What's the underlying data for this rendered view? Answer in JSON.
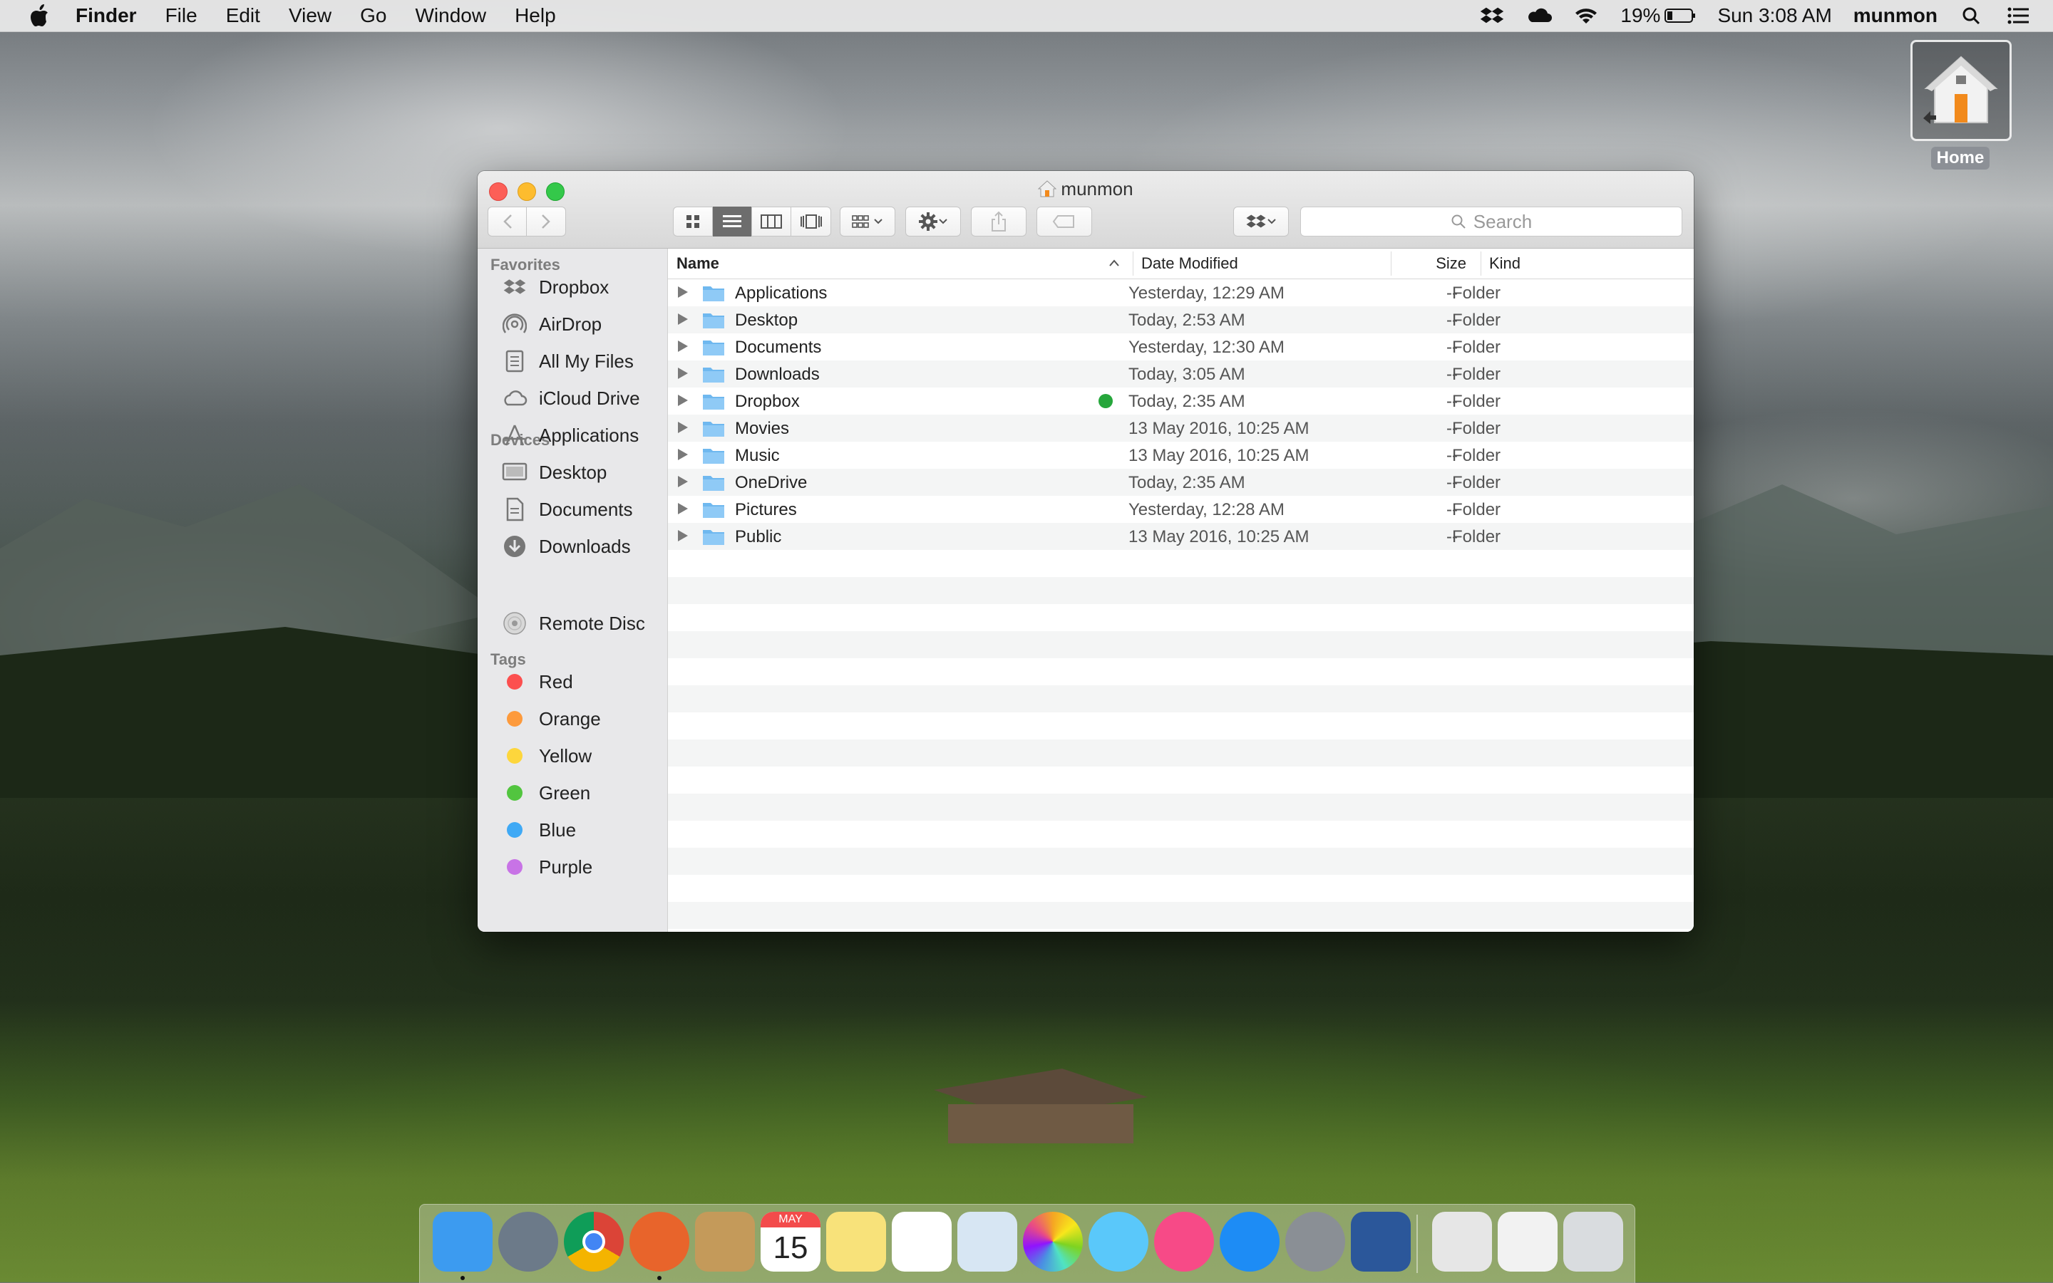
{
  "menubar": {
    "app_name": "Finder",
    "items": [
      "File",
      "Edit",
      "View",
      "Go",
      "Window",
      "Help"
    ],
    "battery": "19%",
    "clock": "Sun 3:08 AM",
    "user": "munmon"
  },
  "desktop": {
    "home_label": "Home"
  },
  "window": {
    "title": "munmon",
    "search_placeholder": "Search"
  },
  "sidebar": {
    "favorites_header": "Favorites",
    "favorites": [
      {
        "label": "Dropbox",
        "icon": "dropbox-icon"
      },
      {
        "label": "AirDrop",
        "icon": "airdrop-icon"
      },
      {
        "label": "All My Files",
        "icon": "all-files-icon"
      },
      {
        "label": "iCloud Drive",
        "icon": "cloud-icon"
      },
      {
        "label": "Applications",
        "icon": "applications-icon"
      },
      {
        "label": "Desktop",
        "icon": "desktop-icon"
      },
      {
        "label": "Documents",
        "icon": "document-icon"
      },
      {
        "label": "Downloads",
        "icon": "download-icon"
      }
    ],
    "devices_header": "Devices",
    "devices": [
      {
        "label": "Remote Disc",
        "icon": "disc-icon"
      }
    ],
    "tags_header": "Tags",
    "tags": [
      {
        "label": "Red",
        "color": "#fc4f4f"
      },
      {
        "label": "Orange",
        "color": "#fd9a3c"
      },
      {
        "label": "Yellow",
        "color": "#fdd63c"
      },
      {
        "label": "Green",
        "color": "#52c53f"
      },
      {
        "label": "Blue",
        "color": "#3fa9f5"
      },
      {
        "label": "Purple",
        "color": "#c873e6"
      }
    ]
  },
  "columns": {
    "name": "Name",
    "date": "Date Modified",
    "size": "Size",
    "kind": "Kind"
  },
  "files": [
    {
      "name": "Applications",
      "date": "Yesterday, 12:29 AM",
      "size": "--",
      "kind": "Folder",
      "synced": false
    },
    {
      "name": "Desktop",
      "date": "Today, 2:53 AM",
      "size": "--",
      "kind": "Folder",
      "synced": false
    },
    {
      "name": "Documents",
      "date": "Yesterday, 12:30 AM",
      "size": "--",
      "kind": "Folder",
      "synced": false
    },
    {
      "name": "Downloads",
      "date": "Today, 3:05 AM",
      "size": "--",
      "kind": "Folder",
      "synced": false
    },
    {
      "name": "Dropbox",
      "date": "Today, 2:35 AM",
      "size": "--",
      "kind": "Folder",
      "synced": true
    },
    {
      "name": "Movies",
      "date": "13 May 2016, 10:25 AM",
      "size": "--",
      "kind": "Folder",
      "synced": false
    },
    {
      "name": "Music",
      "date": "13 May 2016, 10:25 AM",
      "size": "--",
      "kind": "Folder",
      "synced": false
    },
    {
      "name": "OneDrive",
      "date": "Today, 2:35 AM",
      "size": "--",
      "kind": "Folder",
      "synced": false
    },
    {
      "name": "Pictures",
      "date": "Yesterday, 12:28 AM",
      "size": "--",
      "kind": "Folder",
      "synced": false
    },
    {
      "name": "Public",
      "date": "13 May 2016, 10:25 AM",
      "size": "--",
      "kind": "Folder",
      "synced": false
    }
  ],
  "dock": {
    "calendar_month": "MAY",
    "calendar_day": "15",
    "apps": [
      {
        "name": "finder-icon",
        "color": "#3c9bf0",
        "running": true
      },
      {
        "name": "launchpad-icon",
        "color": "#6c7a89",
        "running": false
      },
      {
        "name": "chrome-icon",
        "color": "#e8e8e8",
        "running": false
      },
      {
        "name": "firefox-icon",
        "color": "#e8642b",
        "running": true
      },
      {
        "name": "contacts-icon",
        "color": "#c49a5a",
        "running": false
      },
      {
        "name": "calendar-icon",
        "color": "#ffffff",
        "running": false
      },
      {
        "name": "notes-icon",
        "color": "#f8e27a",
        "running": false
      },
      {
        "name": "reminders-icon",
        "color": "#ffffff",
        "running": false
      },
      {
        "name": "preview-icon",
        "color": "#d7e6f3",
        "running": false
      },
      {
        "name": "photos-icon",
        "color": "#ffffff",
        "running": false
      },
      {
        "name": "messages-icon",
        "color": "#5ac8fa",
        "running": false
      },
      {
        "name": "itunes-icon",
        "color": "#f74a87",
        "running": false
      },
      {
        "name": "app-store-icon",
        "color": "#1d8cf5",
        "running": false
      },
      {
        "name": "system-preferences-icon",
        "color": "#8a8f95",
        "running": false
      },
      {
        "name": "word-icon",
        "color": "#2b579a",
        "running": false
      },
      {
        "name": "document-stack-icon",
        "color": "#e6e6e6",
        "running": false
      },
      {
        "name": "downloads-stack-icon",
        "color": "#f2f2f2",
        "running": false
      },
      {
        "name": "trash-icon",
        "color": "#d9dcdf",
        "running": false
      }
    ]
  }
}
